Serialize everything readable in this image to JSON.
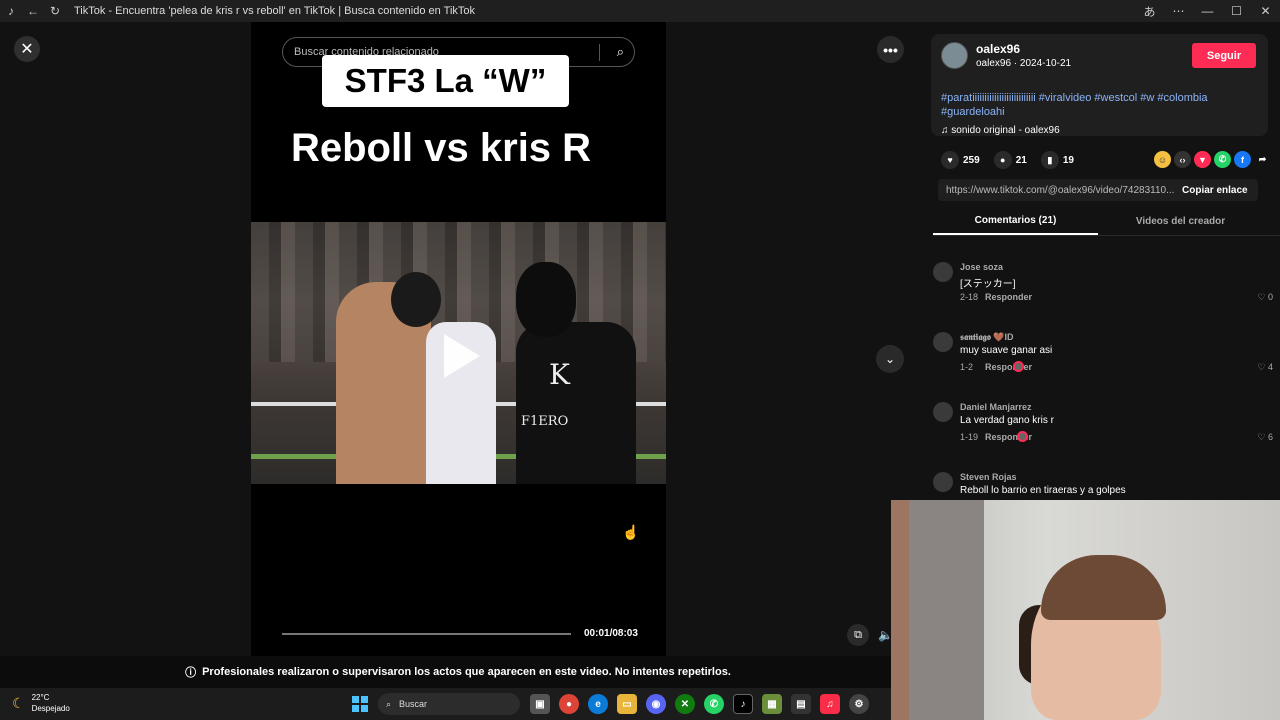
{
  "window": {
    "title": "TikTok - Encuentra 'pelea de kris r vs reboll' en TikTok | Busca contenido en TikTok"
  },
  "video": {
    "search_placeholder": "Buscar contenido relacionado",
    "overlay_box_text": "STF3 La “W”",
    "headline_text": "Reboll vs kris R",
    "frame_k": "K",
    "frame_fierro": "F1ERO",
    "time": "00:01/08:03",
    "progress": 0.002
  },
  "warning": {
    "text": "Profesionales realizaron o supervisaron los actos que aparecen en este video. No intentes repetirlos."
  },
  "post": {
    "username": "oalex96",
    "subline": "oalex96 · 2024-10-21",
    "follow_label": "Seguir",
    "hashtags": "#paratiiiiiiiiiiiiiiiiiiiiiiiiii #viralvideo #westcol #w #colombia #guardeloahi",
    "sound": "sonido original - oalex96",
    "likes": "259",
    "comments_count": "21",
    "saves": "19",
    "link": "https://www.tiktok.com/@oalex96/video/74283110...",
    "copy_label": "Copiar enlace"
  },
  "tabs": {
    "comments": "Comentarios (21)",
    "creator_videos": "Videos del creador"
  },
  "comments": [
    {
      "name": "Jose soza",
      "text": "[ステッカー]",
      "date": "2-18",
      "reply": "Responder",
      "likes": "0",
      "creator_liked": false
    },
    {
      "name": "𝖘𝖆𝖓𝖙𝖎𝖆𝖌𝖔 🤎ID",
      "text": "muy suave ganar asi",
      "date": "1-2",
      "reply": "Responder",
      "likes": "4",
      "creator_liked": true
    },
    {
      "name": "Daniel Manjarrez",
      "text": "La verdad gano kris r",
      "date": "1-19",
      "reply": "Responder",
      "likes": "6",
      "creator_liked": true
    },
    {
      "name": "Steven Rojas",
      "text": "Reboll lo barrio en tiraeras y a golpes",
      "date": "",
      "reply": "",
      "likes": "",
      "creator_liked": false
    }
  ],
  "taskbar": {
    "temp": "22°C",
    "condition": "Despejado",
    "search_label": "Buscar"
  },
  "colors": {
    "accent": "#fe2c55",
    "hashtag": "#8ab4f8"
  }
}
